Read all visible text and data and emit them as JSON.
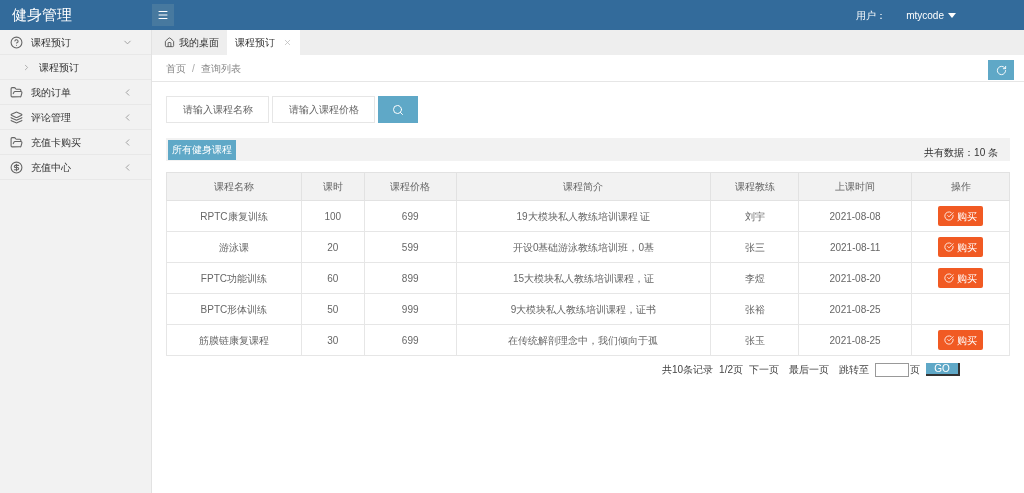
{
  "header": {
    "title": "健身管理",
    "user_label": "用户：",
    "user_name": "mtycode"
  },
  "sidebar": {
    "items": [
      {
        "label": "课程预订",
        "kind": "question",
        "expanded": true,
        "children": [
          {
            "label": "课程预订"
          }
        ]
      },
      {
        "label": "我的订单",
        "kind": "folder",
        "expanded": false
      },
      {
        "label": "评论管理",
        "kind": "layers",
        "expanded": false
      },
      {
        "label": "充值卡购买",
        "kind": "folder",
        "expanded": false
      },
      {
        "label": "充值中心",
        "kind": "coin",
        "expanded": false
      }
    ]
  },
  "tabs": [
    {
      "label": "我的桌面",
      "selected": false,
      "closable": false
    },
    {
      "label": "课程预订",
      "selected": true,
      "closable": true
    }
  ],
  "breadcrumb": {
    "items": [
      "首页",
      "查询列表"
    ],
    "separator": "/"
  },
  "search": {
    "fields": [
      {
        "placeholder": "请输入课程名称"
      },
      {
        "placeholder": "请输入课程价格"
      }
    ]
  },
  "toolbar": {
    "button": "所有健身课程",
    "total": "共有数据：10 条"
  },
  "table": {
    "columns": [
      "课程名称",
      "课时",
      "课程价格",
      "课程简介",
      "课程教练",
      "上课时间",
      "操作"
    ],
    "rows": [
      {
        "cells": [
          "RPTC康复训练",
          "100",
          "699",
          "19大模块私人教练培训课程 证",
          "刘宇",
          "2021-08-08"
        ],
        "action": "购买"
      },
      {
        "cells": [
          "游泳课",
          "20",
          "599",
          "开设0基础游泳教练培训班，0基",
          "张三",
          "2021-08-11"
        ],
        "action": "购买"
      },
      {
        "cells": [
          "FPTC功能训练",
          "60",
          "899",
          "15大模块私人教练培训课程，证",
          "李煜",
          "2021-08-20"
        ],
        "action": "购买"
      },
      {
        "cells": [
          "BPTC形体训练",
          "50",
          "999",
          "9大模块私人教练培训课程，证书",
          "张裕",
          "2021-08-25"
        ]
      },
      {
        "cells": [
          "筋膜链康复课程",
          "30",
          "699",
          "在传统解剖理念中，我们倾向于孤",
          "张玉",
          "2021-08-25"
        ],
        "action": "购买"
      }
    ]
  },
  "pagination": {
    "summary": "共10条记录",
    "page": "1/2页",
    "next": "下一页",
    "last": "最后一页",
    "jump_label": "跳转至",
    "jump_suffix": "页",
    "go": "GO"
  }
}
